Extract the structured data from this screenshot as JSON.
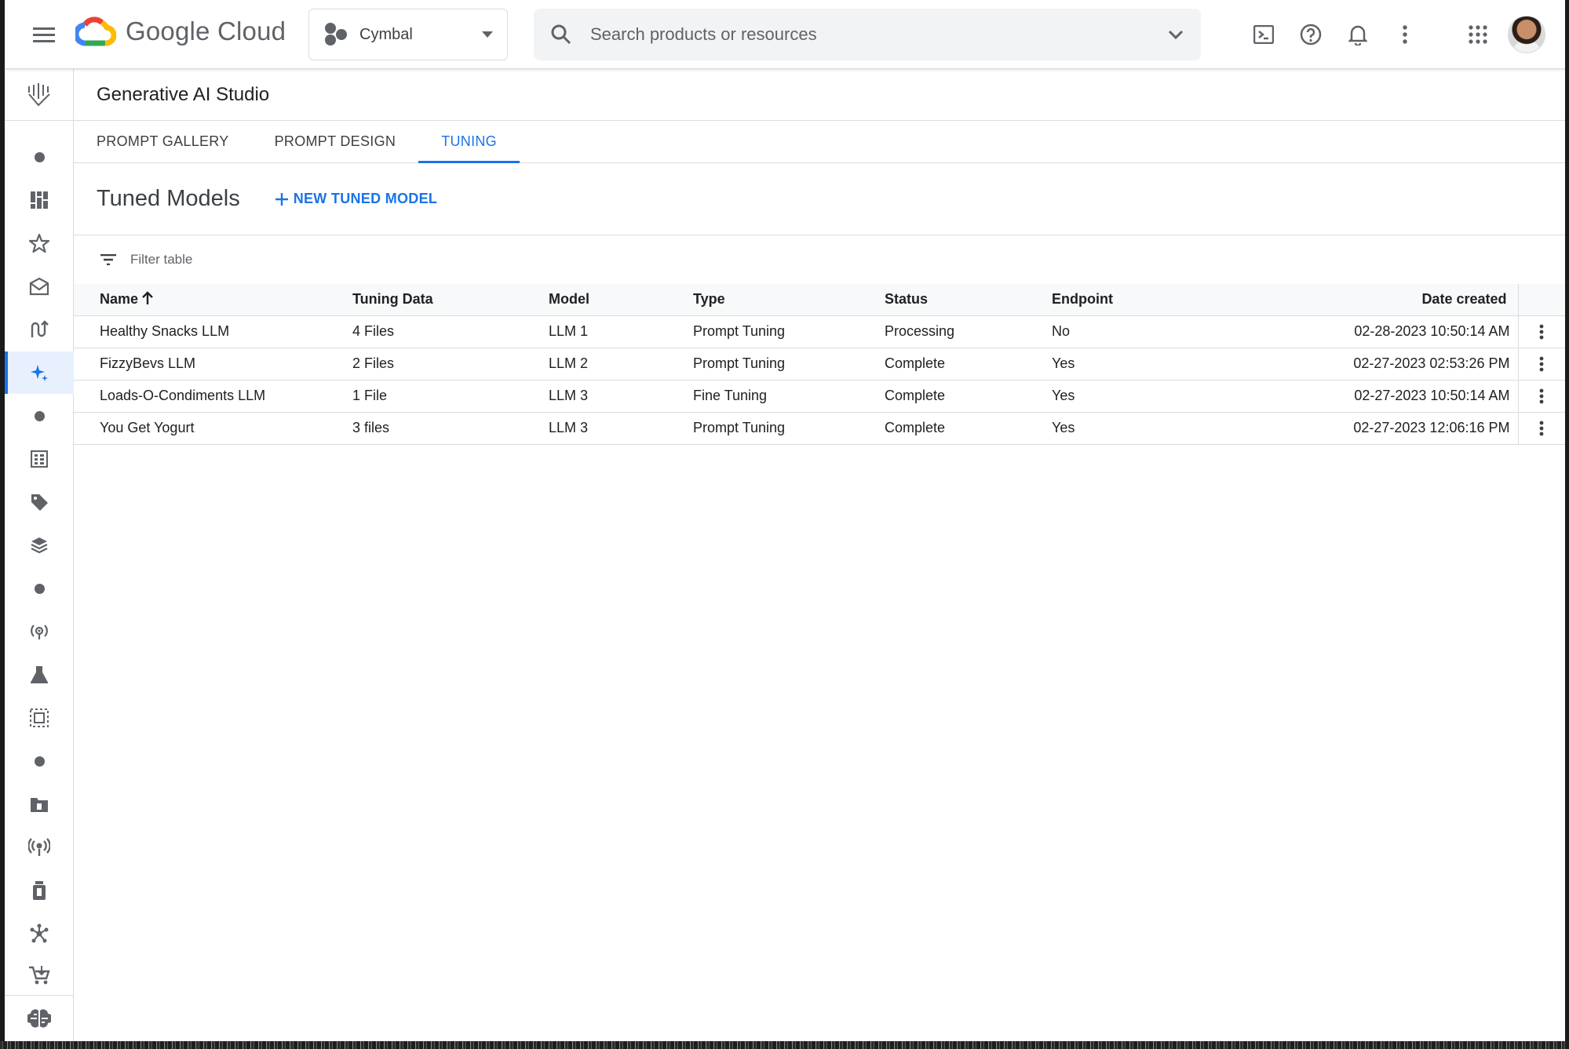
{
  "topbar": {
    "menu_icon": "hamburger-menu-icon",
    "brand": "Google Cloud",
    "project": "Cymbal",
    "search_placeholder": "Search products or resources",
    "icons": [
      "cloud-shell-icon",
      "help-icon",
      "notifications-icon",
      "more-vert-icon",
      "apps-grid-icon"
    ]
  },
  "rail": {
    "items": [
      "dot-icon",
      "dashboard-icon",
      "star-icon",
      "model-garden-icon",
      "pipelines-icon",
      "generative-ai-sparkle-icon",
      "dot-icon",
      "datasets-icon",
      "labeling-tag-icon",
      "feature-store-icon",
      "dot-icon",
      "training-icon",
      "experiments-flask-icon",
      "workbench-icon",
      "dot-icon",
      "model-registry-icon",
      "endpoints-broadcast-icon",
      "batch-predictions-icon",
      "matching-engine-icon",
      "marketplace-cart-icon"
    ],
    "active_index": 5
  },
  "page": {
    "title": "Generative AI Studio",
    "tabs": [
      {
        "label": "PROMPT GALLERY",
        "active": false
      },
      {
        "label": "PROMPT DESIGN",
        "active": false
      },
      {
        "label": "TUNING",
        "active": true
      }
    ],
    "section_title": "Tuned Models",
    "new_button": "NEW TUNED MODEL",
    "filter_placeholder": "Filter table"
  },
  "table": {
    "columns": [
      "Name",
      "Tuning Data",
      "Model",
      "Type",
      "Status",
      "Endpoint",
      "Date created"
    ],
    "sort_column": "Name",
    "rows": [
      [
        "Healthy Snacks LLM",
        "4 Files",
        "LLM 1",
        "Prompt Tuning",
        "Processing",
        "No",
        "02-28-2023 10:50:14 AM"
      ],
      [
        "FizzyBevs LLM",
        "2 Files",
        "LLM 2",
        "Prompt Tuning",
        "Complete",
        "Yes",
        "02-27-2023 02:53:26 PM"
      ],
      [
        "Loads-O-Condiments LLM",
        "1 File",
        "LLM 3",
        "Fine Tuning",
        "Complete",
        "Yes",
        "02-27-2023 10:50:14 AM"
      ],
      [
        "You Get Yogurt",
        "3 files",
        "LLM 3",
        "Prompt Tuning",
        "Complete",
        "Yes",
        "02-27-2023 12:06:16 PM"
      ]
    ]
  },
  "colors": {
    "accent": "#1a73e8",
    "text": "#202124",
    "muted": "#5f6368",
    "border": "#dadce0",
    "search_bg": "#f1f3f4"
  }
}
